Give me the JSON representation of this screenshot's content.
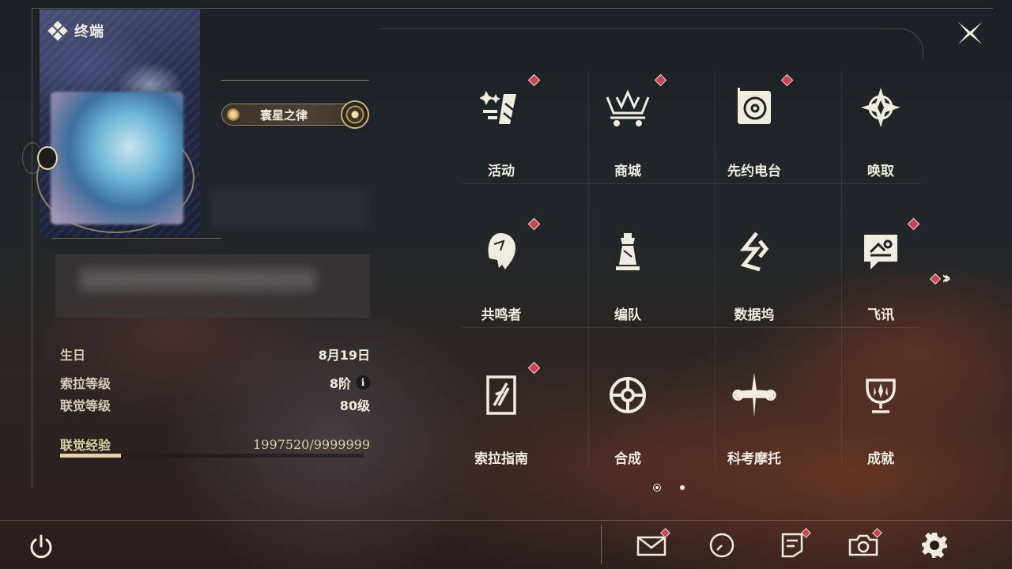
{
  "header": {
    "title": "终端",
    "icon": "diamond-cluster-icon"
  },
  "profile": {
    "title_badge": "寰星之律",
    "stats": {
      "birthday_label": "生日",
      "birthday_value": "8月19日",
      "sola_level_label": "索拉等级",
      "sola_level_value": "8阶",
      "union_level_label": "联觉等级",
      "union_level_value": "80级",
      "union_exp_label": "联觉经验",
      "union_exp_value": "1997520/9999999",
      "union_exp_fraction": 0.1998
    }
  },
  "menu": {
    "items": [
      {
        "label": "活动",
        "icon": "activity-icon",
        "badge": true
      },
      {
        "label": "商城",
        "icon": "shop-icon",
        "badge": true
      },
      {
        "label": "先约电台",
        "icon": "radio-icon",
        "badge": true
      },
      {
        "label": "唤取",
        "icon": "convene-icon",
        "badge": false
      },
      {
        "label": "共鸣者",
        "icon": "resonator-icon",
        "badge": true
      },
      {
        "label": "编队",
        "icon": "team-icon",
        "badge": false
      },
      {
        "label": "数据坞",
        "icon": "data-bank-icon",
        "badge": false
      },
      {
        "label": "飞讯",
        "icon": "chat-icon",
        "badge": true
      },
      {
        "label": "索拉指南",
        "icon": "guide-icon",
        "badge": true
      },
      {
        "label": "合成",
        "icon": "synthesis-icon",
        "badge": false
      },
      {
        "label": "科考摩托",
        "icon": "motorbike-icon",
        "badge": false
      },
      {
        "label": "成就",
        "icon": "trophy-icon",
        "badge": false
      }
    ],
    "next_page_badge": true,
    "pager": {
      "current": 1,
      "total": 2
    }
  },
  "bottom_bar": {
    "buttons": [
      {
        "name": "mail",
        "icon": "mail-icon",
        "badge": true
      },
      {
        "name": "clock",
        "icon": "clock-icon",
        "badge": false
      },
      {
        "name": "notice",
        "icon": "notice-icon",
        "badge": true
      },
      {
        "name": "camera",
        "icon": "camera-icon",
        "badge": true
      },
      {
        "name": "settings",
        "icon": "gear-icon",
        "badge": false
      }
    ]
  },
  "colors": {
    "accent_red": "#c8444e",
    "text_light": "#f2ede0",
    "gold": "#e0cfa6"
  }
}
